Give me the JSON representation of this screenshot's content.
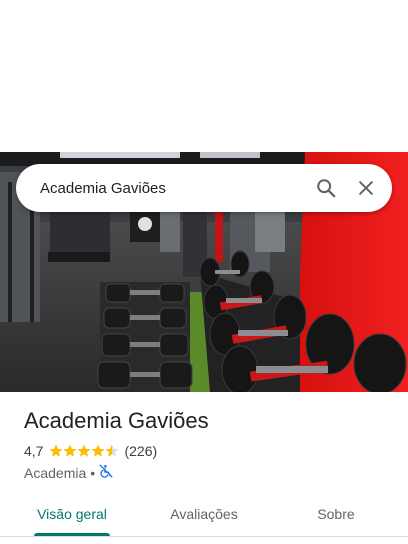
{
  "search": {
    "query": "Academia Gaviões",
    "search_icon": "search-icon",
    "close_icon": "close-icon"
  },
  "hero": {
    "description_icon": "gym-photo"
  },
  "place": {
    "title": "Academia Gaviões",
    "rating": "4,7",
    "stars_filled": 4.5,
    "reviews": "(226)",
    "category": "Academia",
    "separator": "•",
    "accessibility_icon": "not-wheelchair-accessible-icon"
  },
  "tabs": [
    {
      "label": "Visão geral",
      "active": true
    },
    {
      "label": "Avaliações",
      "active": false
    },
    {
      "label": "Sobre",
      "active": false
    }
  ],
  "colors": {
    "accent": "#00796b",
    "star": "#fbbc04",
    "accessibility_icon": "#1a73e8"
  }
}
